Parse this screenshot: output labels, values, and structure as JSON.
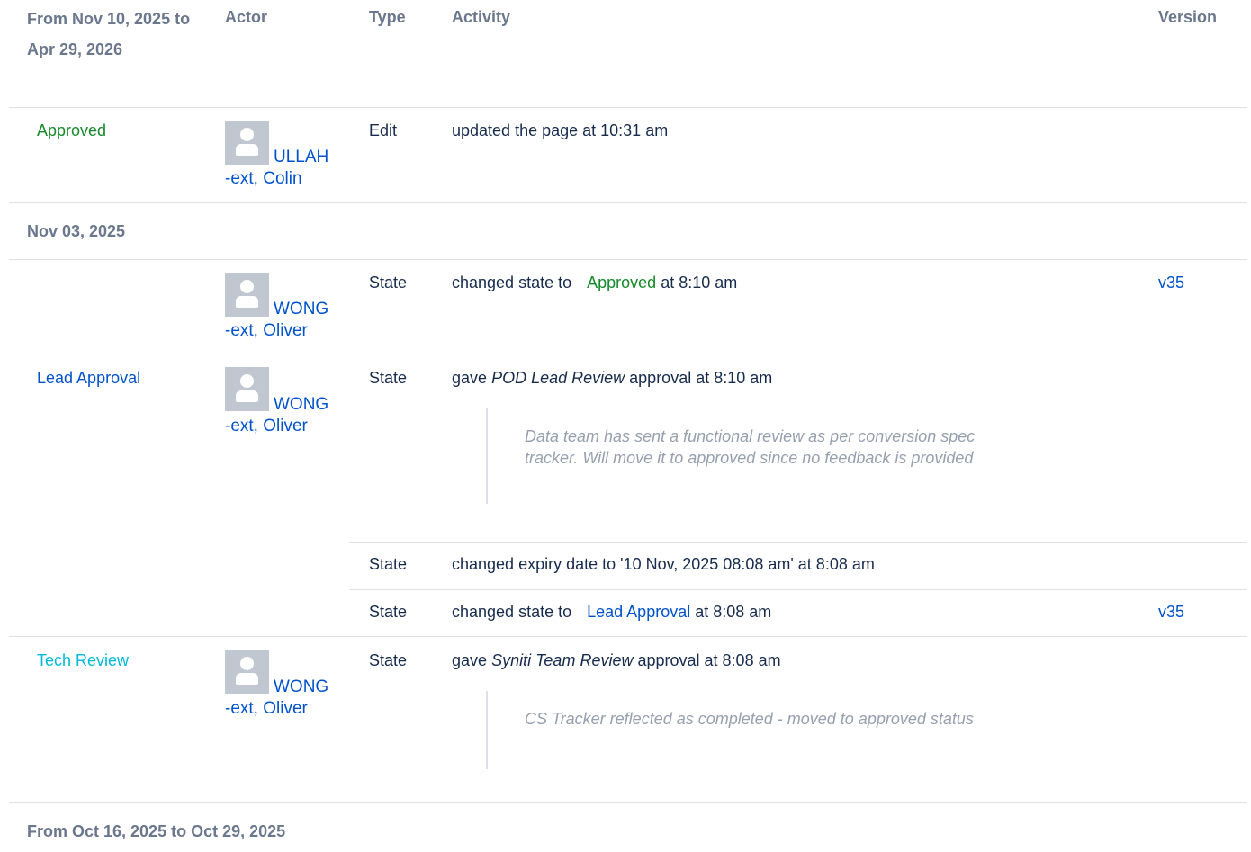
{
  "headers": {
    "date_range": "From Nov 10, 2025 to Apr 29, 2026",
    "actor": "Actor",
    "type": "Type",
    "activity": "Activity",
    "version": "Version"
  },
  "groups": {
    "g2": "Nov 03, 2025",
    "g3": "From Oct 16, 2025 to Oct 29, 2025"
  },
  "rows": [
    {
      "state_label": "Approved",
      "actor_line1": "ULLAH",
      "actor_line2": "-ext, Colin",
      "type": "Edit",
      "activity": "updated the page at 10:31 am",
      "version": ""
    },
    {
      "state_label": "",
      "actor_line1": "WONG",
      "actor_line2": "-ext, Oliver",
      "type": "State",
      "activity_pre": "changed state to",
      "activity_state": "Approved",
      "activity_post": "at 8:10 am",
      "version": "v35"
    },
    {
      "state_label": "Lead Approval",
      "actor_line1": "WONG",
      "actor_line2": "-ext, Oliver",
      "type": "State",
      "activity_pre": "gave",
      "activity_em": "POD Lead Review",
      "activity_post": "approval at 8:10 am",
      "comment": "Data team has sent a functional review as per conversion spec tracker. Will move it to approved since no feedback is provided"
    },
    {
      "type": "State",
      "activity": "changed expiry date to '10 Nov, 2025 08:08 am' at 8:08 am"
    },
    {
      "type": "State",
      "activity_pre": "changed state to",
      "activity_state": "Lead Approval",
      "activity_post": "at 8:08 am",
      "version": "v35"
    },
    {
      "state_label": "Tech Review",
      "actor_line1": "WONG",
      "actor_line2": "-ext, Oliver",
      "type": "State",
      "activity_pre": "gave",
      "activity_em": "Syniti Team Review",
      "activity_post": "approval at 8:08 am",
      "comment": "CS Tracker reflected as completed - moved to approved status"
    }
  ],
  "colors": {
    "approved": "#168a2a",
    "link": "#0052cc",
    "tech_review": "#00b8d9",
    "muted": "#6b778c"
  },
  "icons": [
    "user-avatar-icon"
  ]
}
